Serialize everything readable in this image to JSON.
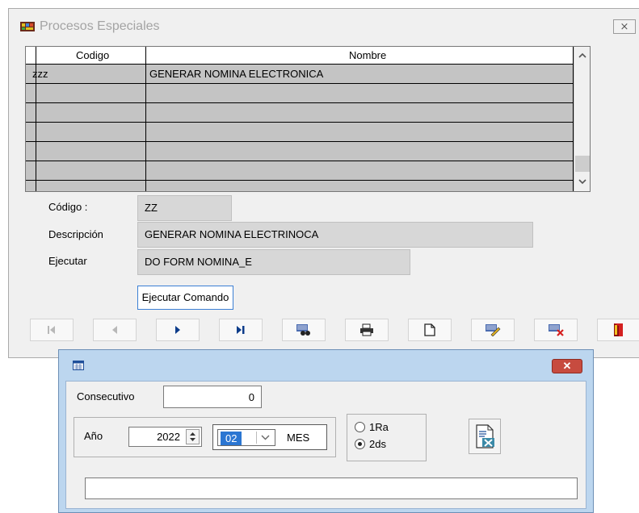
{
  "main_window": {
    "title": "Procesos Especiales",
    "close_symbol": "⨯"
  },
  "grid": {
    "columns": [
      "Codigo",
      "Nombre"
    ],
    "rows": [
      {
        "codigo": "zzz",
        "nombre": "GENERAR NOMINA ELECTRONICA"
      }
    ]
  },
  "form": {
    "codigo_label": "Código :",
    "codigo_value": "ZZ",
    "descripcion_label": "Descripción",
    "descripcion_value": "GENERAR NOMINA ELECTRINOCA",
    "ejecutar_label": "Ejecutar",
    "ejecutar_value": "DO FORM NOMINA_E",
    "ejecutar_button": "Ejecutar Comando"
  },
  "toolbar": {
    "buttons": [
      "first-record-icon",
      "previous-record-icon",
      "next-record-icon",
      "last-record-icon",
      "search-binoculars-icon",
      "print-icon",
      "new-document-icon",
      "edit-icon",
      "delete-icon",
      "exit-door-icon"
    ]
  },
  "dialog": {
    "consecutivo_label": "Consecutivo",
    "consecutivo_value": "0",
    "ano_label": "Año",
    "ano_value": "2022",
    "mes_value": "02",
    "mes_label": "MES",
    "radio_1": "1Ra",
    "radio_2": "2ds",
    "radio_selected": "2ds",
    "status_text": "",
    "close_symbol": "✕"
  },
  "colors": {
    "dialog_frame": "#bcd6ef",
    "close_red": "#c74b3f",
    "row_selected": "#c4c4c4",
    "field_gray": "#d7d7d7",
    "focus_blue": "#3b7fd4"
  }
}
